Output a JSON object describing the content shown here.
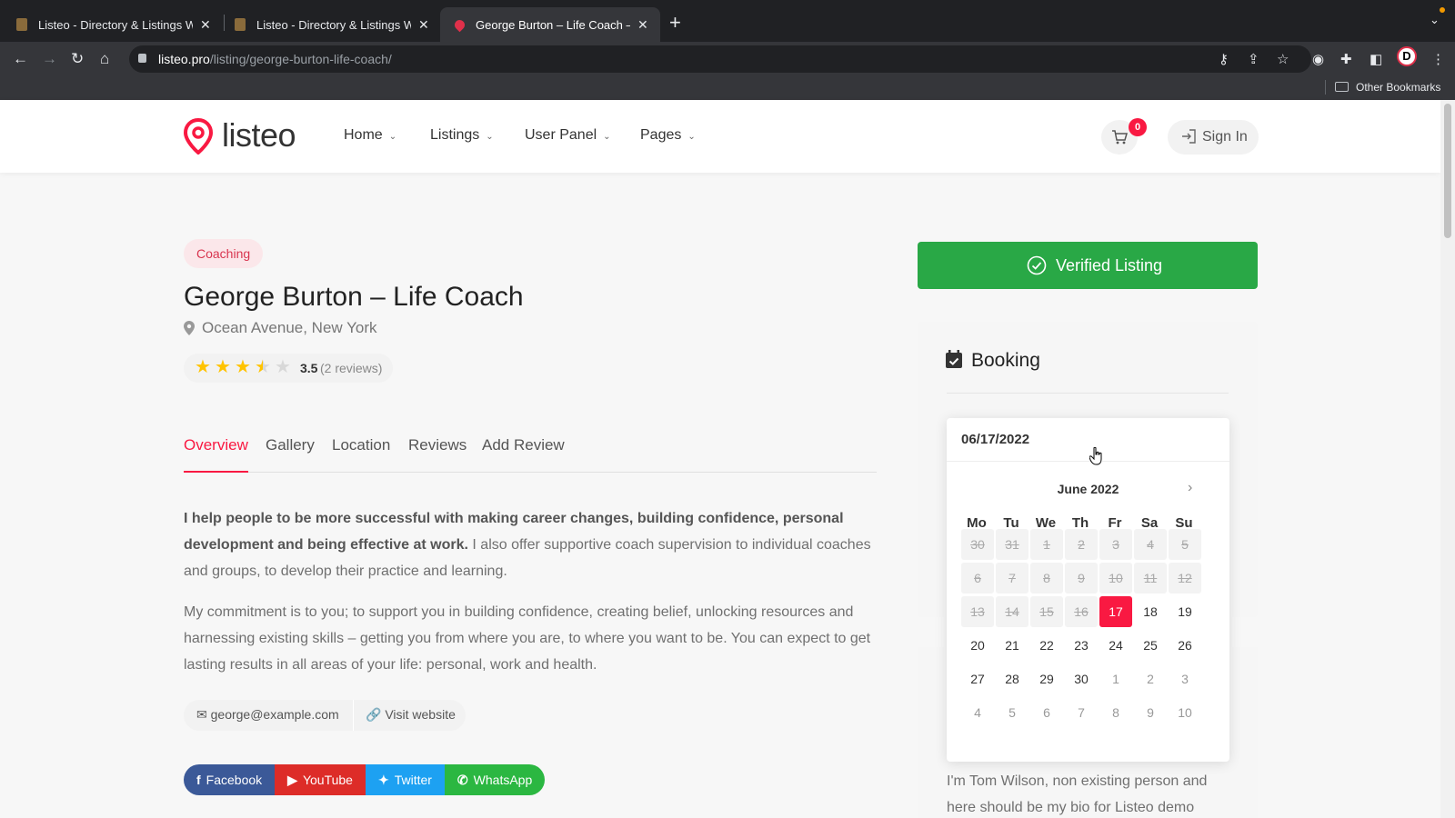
{
  "browser": {
    "tabs": [
      {
        "title": "Listeo - Directory & Listings W",
        "active": false
      },
      {
        "title": "Listeo - Directory & Listings W",
        "active": false
      },
      {
        "title": "George Burton – Life Coach – L",
        "active": true
      }
    ],
    "url_host": "listeo.pro",
    "url_path": "/listing/george-burton-life-coach/",
    "profile_initial": "D",
    "bookmarks_label": "Other Bookmarks"
  },
  "header": {
    "logo": "listeo",
    "nav": [
      "Home",
      "Listings",
      "User Panel",
      "Pages"
    ],
    "cart_count": "0",
    "signin": "Sign In"
  },
  "listing": {
    "category": "Coaching",
    "title": "George Burton – Life Coach",
    "location": "Ocean Avenue, New York",
    "rating": 3.5,
    "rating_label": "3.5",
    "reviews": "(2 reviews)",
    "tabs": [
      "Overview",
      "Gallery",
      "Location",
      "Reviews",
      "Add Review"
    ],
    "intro_bold": "I help people to be more successful with making career changes, building confidence, personal development and being effective at work.",
    "intro_rest": " I also offer supportive coach supervision to individual coaches and groups, to develop their practice and learning.",
    "para2": "My commitment is to you; to support you in building confidence, creating belief, unlocking resources and harnessing existing skills – getting you from where you are, to where you want to be. You can expect to get lasting results in all areas of your life: personal, work and health.",
    "email": "george@example.com",
    "website": "Visit website",
    "socials": [
      {
        "label": "Facebook",
        "icon": "f",
        "color": "#3b5998"
      },
      {
        "label": "YouTube",
        "icon": "▶",
        "color": "#dd2c28"
      },
      {
        "label": "Twitter",
        "icon": "🐦",
        "color": "#1da1f2"
      },
      {
        "label": "WhatsApp",
        "icon": "✆",
        "color": "#2bb741"
      }
    ]
  },
  "sidebar": {
    "verified": "Verified Listing",
    "booking_title": "Booking",
    "date_value": "06/17/2022",
    "month_label": "June 2022",
    "weekdays": [
      "Mo",
      "Tu",
      "We",
      "Th",
      "Fr",
      "Sa",
      "Su"
    ],
    "weeks": [
      [
        {
          "d": "30",
          "s": "past"
        },
        {
          "d": "31",
          "s": "past"
        },
        {
          "d": "1",
          "s": "past"
        },
        {
          "d": "2",
          "s": "past"
        },
        {
          "d": "3",
          "s": "past"
        },
        {
          "d": "4",
          "s": "past"
        },
        {
          "d": "5",
          "s": "past"
        }
      ],
      [
        {
          "d": "6",
          "s": "past"
        },
        {
          "d": "7",
          "s": "past"
        },
        {
          "d": "8",
          "s": "past"
        },
        {
          "d": "9",
          "s": "past"
        },
        {
          "d": "10",
          "s": "past"
        },
        {
          "d": "11",
          "s": "past"
        },
        {
          "d": "12",
          "s": "past"
        }
      ],
      [
        {
          "d": "13",
          "s": "past"
        },
        {
          "d": "14",
          "s": "past"
        },
        {
          "d": "15",
          "s": "past"
        },
        {
          "d": "16",
          "s": "past"
        },
        {
          "d": "17",
          "s": "sel"
        },
        {
          "d": "18",
          "s": "avail"
        },
        {
          "d": "19",
          "s": "avail"
        }
      ],
      [
        {
          "d": "20",
          "s": "avail"
        },
        {
          "d": "21",
          "s": "avail"
        },
        {
          "d": "22",
          "s": "avail"
        },
        {
          "d": "23",
          "s": "avail"
        },
        {
          "d": "24",
          "s": "avail"
        },
        {
          "d": "25",
          "s": "avail"
        },
        {
          "d": "26",
          "s": "avail"
        }
      ],
      [
        {
          "d": "27",
          "s": "avail"
        },
        {
          "d": "28",
          "s": "avail"
        },
        {
          "d": "29",
          "s": "avail"
        },
        {
          "d": "30",
          "s": "avail"
        },
        {
          "d": "1",
          "s": "next"
        },
        {
          "d": "2",
          "s": "next"
        },
        {
          "d": "3",
          "s": "next"
        }
      ],
      [
        {
          "d": "4",
          "s": "next"
        },
        {
          "d": "5",
          "s": "next"
        },
        {
          "d": "6",
          "s": "next"
        },
        {
          "d": "7",
          "s": "next"
        },
        {
          "d": "8",
          "s": "next"
        },
        {
          "d": "9",
          "s": "next"
        },
        {
          "d": "10",
          "s": "next"
        }
      ]
    ],
    "bio": "I'm Tom Wilson, non existing person and here should be my bio for Listeo demo"
  }
}
